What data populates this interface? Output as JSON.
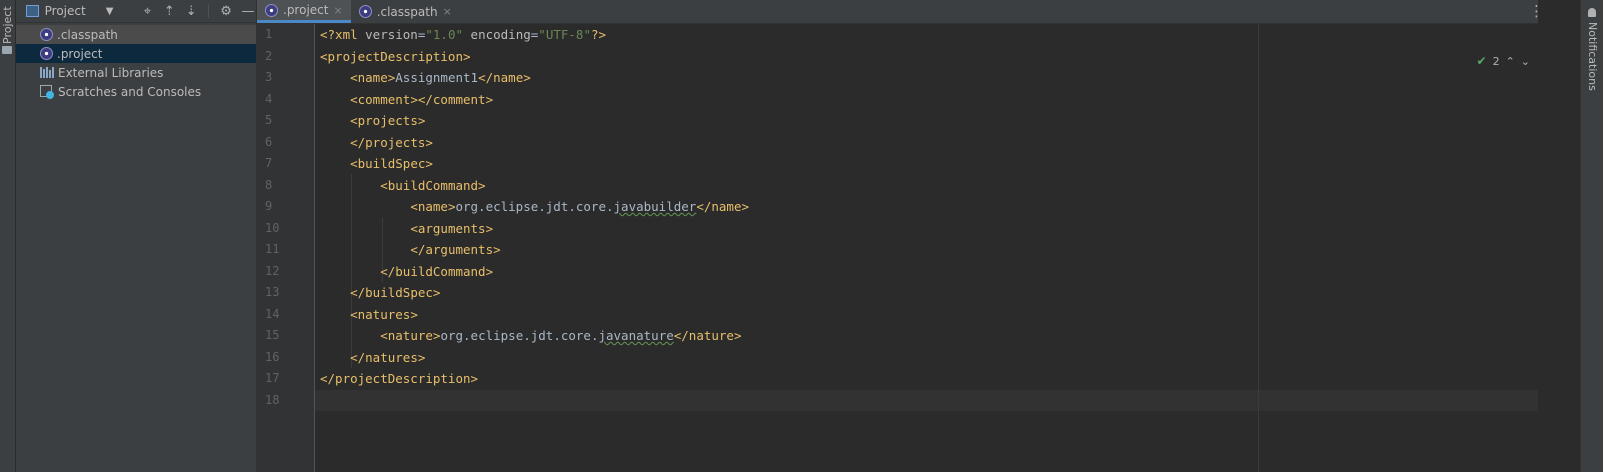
{
  "left_stripe": {
    "label": "Project"
  },
  "project_panel": {
    "title": "Project",
    "caret": "▼",
    "tools": {
      "locate": "⌖",
      "expand": "⇡",
      "collapse": "⇣",
      "settings": "⚙",
      "hide": "—"
    },
    "items": [
      {
        "label": ".classpath",
        "icon": "xml-file-icon"
      },
      {
        "label": ".project",
        "icon": "xml-file-icon"
      },
      {
        "label": "External Libraries",
        "icon": "library-icon"
      },
      {
        "label": "Scratches and Consoles",
        "icon": "scratches-icon"
      }
    ]
  },
  "tabs": [
    {
      "label": ".project",
      "close": "×",
      "active": true
    },
    {
      "label": ".classpath",
      "close": "×",
      "active": false
    }
  ],
  "tab_more": "⋮",
  "inspection": {
    "check": "✔",
    "count": "2",
    "up": "⌃",
    "down": "⌄"
  },
  "editor": {
    "line_numbers": [
      "1",
      "2",
      "3",
      "4",
      "5",
      "6",
      "7",
      "8",
      "9",
      "10",
      "11",
      "12",
      "13",
      "14",
      "15",
      "16",
      "17",
      "18"
    ],
    "code": {
      "l1_open": "<?xml ",
      "l1_a1": "version",
      "l1_eq1": "=",
      "l1_v1": "\"1.0\"",
      "l1_sp": " ",
      "l1_a2": "encoding",
      "l1_eq2": "=",
      "l1_v2": "\"UTF-8\"",
      "l1_close": "?>",
      "l2": "<projectDescription>",
      "l3_open": "<name>",
      "l3_text": "Assignment1",
      "l3_close": "</name>",
      "l4": "<comment></comment>",
      "l5": "<projects>",
      "l6": "</projects>",
      "l7": "<buildSpec>",
      "l8": "<buildCommand>",
      "l9_open": "<name>",
      "l9_text_a": "org.eclipse.jdt.core.",
      "l9_text_b": "javabuilder",
      "l9_close": "</name>",
      "l10": "<arguments>",
      "l11": "</arguments>",
      "l12": "</buildCommand>",
      "l13": "</buildSpec>",
      "l14": "<natures>",
      "l15_open": "<nature>",
      "l15_text_a": "org.eclipse.jdt.core.",
      "l15_text_b": "javanature",
      "l15_close": "</nature>",
      "l16": "</natures>",
      "l17": "</projectDescription>",
      "l18": ""
    }
  },
  "right_stripe": {
    "label": "Notifications"
  },
  "colors": {
    "tag": "#e8bf6a",
    "string": "#6a8759",
    "background": "#2b2b2b",
    "panel": "#3c3f41",
    "selection": "#0d293e"
  }
}
